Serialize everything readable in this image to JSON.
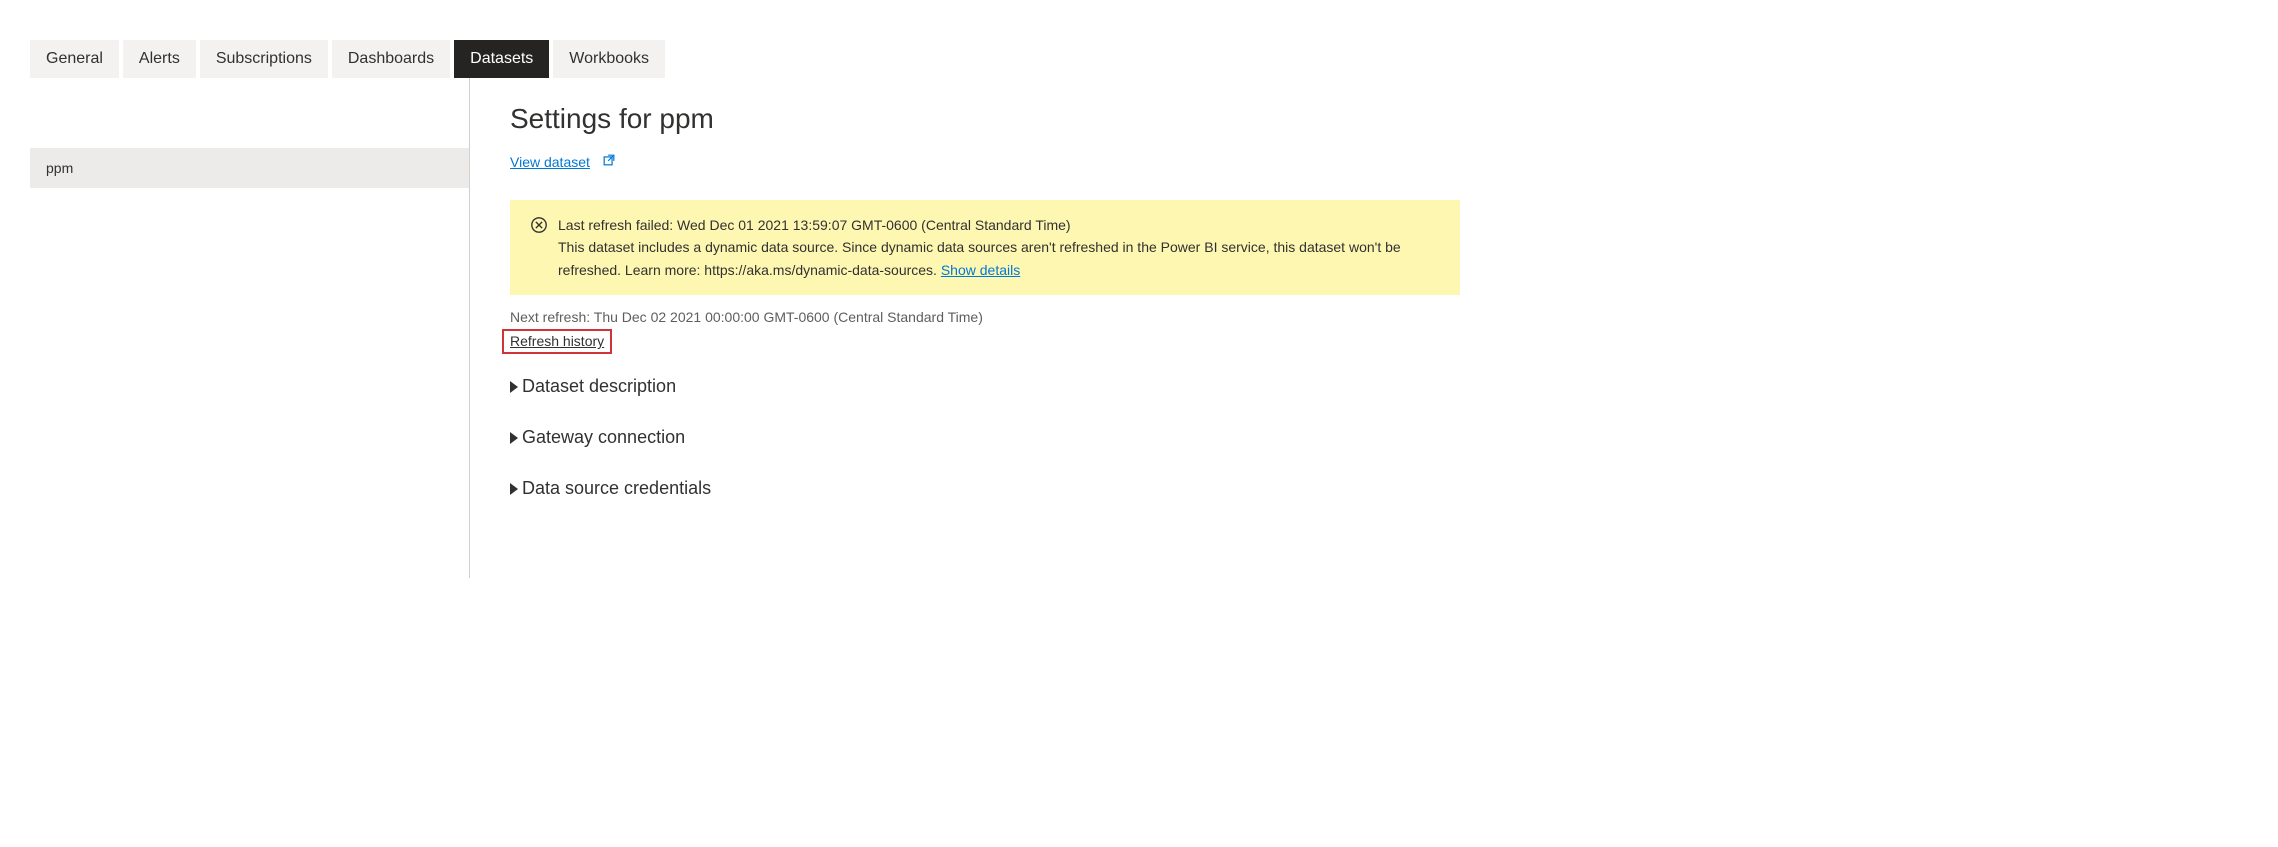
{
  "tabs": {
    "items": [
      {
        "label": "General",
        "active": false
      },
      {
        "label": "Alerts",
        "active": false
      },
      {
        "label": "Subscriptions",
        "active": false
      },
      {
        "label": "Dashboards",
        "active": false
      },
      {
        "label": "Datasets",
        "active": true
      },
      {
        "label": "Workbooks",
        "active": false
      }
    ]
  },
  "sidebar": {
    "items": [
      {
        "label": "ppm"
      }
    ]
  },
  "main": {
    "title": "Settings for ppm",
    "view_dataset_label": "View dataset",
    "warning": {
      "line1": "Last refresh failed: Wed Dec 01 2021 13:59:07 GMT-0600 (Central Standard Time)",
      "line2": "This dataset includes a dynamic data source. Since dynamic data sources aren't refreshed in the Power BI service, this dataset won't be refreshed. Learn more: https://aka.ms/dynamic-data-sources.",
      "show_details_label": "Show details"
    },
    "next_refresh": "Next refresh: Thu Dec 02 2021 00:00:00 GMT-0600 (Central Standard Time)",
    "refresh_history_label": "Refresh history",
    "accordions": [
      {
        "label": "Dataset description"
      },
      {
        "label": "Gateway connection"
      },
      {
        "label": "Data source credentials"
      }
    ]
  }
}
